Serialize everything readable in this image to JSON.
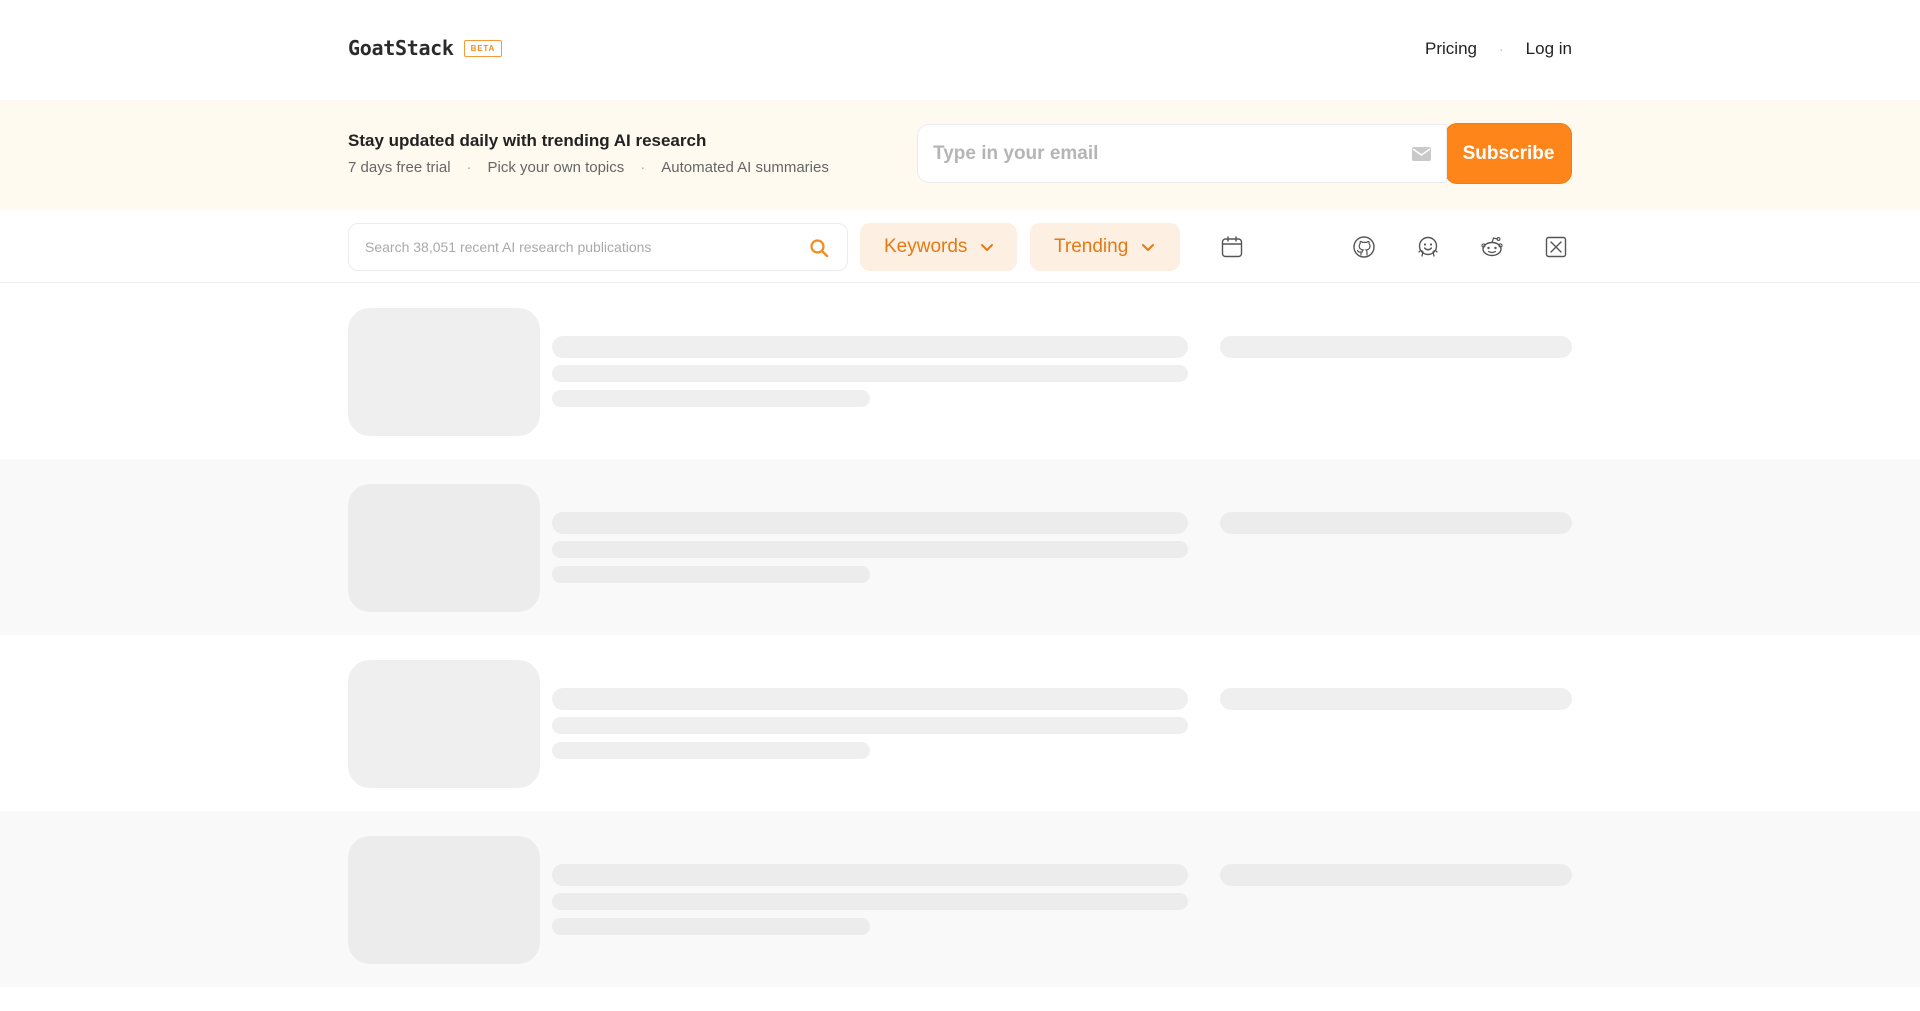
{
  "header": {
    "logo": "GoatStack",
    "badge": "BETA",
    "nav": {
      "pricing": "Pricing",
      "separator": "·",
      "login": "Log in"
    }
  },
  "banner": {
    "title": "Stay updated daily with trending AI research",
    "features": [
      "7 days free trial",
      "Pick your own topics",
      "Automated AI summaries"
    ],
    "feature_separator": "·",
    "email_placeholder": "Type in your email",
    "subscribe_label": "Subscribe"
  },
  "toolbar": {
    "search_placeholder": "Search 38,051 recent AI research publications",
    "keywords_label": "Keywords",
    "trending_label": "Trending",
    "icons": [
      "calendar-icon",
      "github-icon",
      "huggingface-icon",
      "reddit-icon",
      "x-icon"
    ]
  },
  "colors": {
    "accent": "#fd8519",
    "accent_text": "#e47a16",
    "accent_bg": "#fdefe1",
    "banner_bg": "#fffaf0",
    "skeleton": "#efefef"
  },
  "loading_rows": 4
}
